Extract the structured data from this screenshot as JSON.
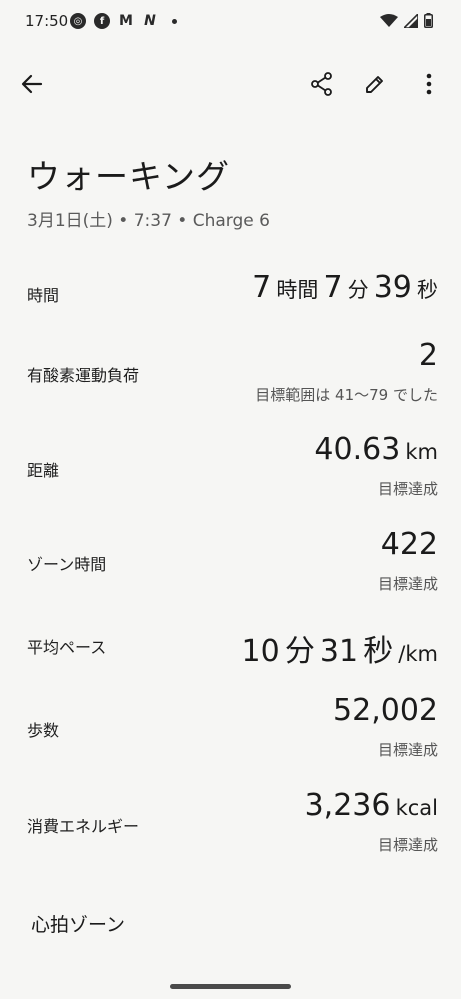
{
  "status_bar": {
    "time": "17:50",
    "left_icons": [
      "activity-icon",
      "facebook-icon",
      "gmail-icon",
      "n-app-icon",
      "notification-dot"
    ],
    "right_icons": [
      "wifi-icon",
      "cell-signal-icon",
      "battery-icon"
    ]
  },
  "app_bar": {
    "back_icon": "arrow-left-icon",
    "actions": [
      "share-icon",
      "edit-icon",
      "more-vert-icon"
    ]
  },
  "header": {
    "title": "ウォーキング",
    "subtitle": "3月1日(土) • 7:37 • Charge 6"
  },
  "stats": {
    "duration": {
      "label": "時間",
      "hours": "7",
      "hours_unit": "時間",
      "minutes": "7",
      "minutes_unit": "分",
      "seconds": "39",
      "seconds_unit": "秒"
    },
    "cardio_load": {
      "label": "有酸素運動負荷",
      "value": "2",
      "note": "目標範囲は 41〜79 でした"
    },
    "distance": {
      "label": "距離",
      "value": "40.63",
      "unit": "km",
      "note": "目標達成"
    },
    "zone_minutes": {
      "label": "ゾーン時間",
      "value": "422",
      "note": "目標達成"
    },
    "avg_pace": {
      "label": "平均ペース",
      "minutes": "10",
      "minutes_unit": "分",
      "seconds": "31",
      "seconds_unit": "秒",
      "per": "/km"
    },
    "steps": {
      "label": "歩数",
      "value": "52,002",
      "note": "目標達成"
    },
    "calories": {
      "label": "消費エネルギー",
      "value": "3,236",
      "unit": "kcal",
      "note": "目標達成"
    }
  },
  "sections": {
    "heart_zones": "心拍ゾーン"
  },
  "colors": {
    "background": "#f6f6f4",
    "text": "#1b1b1b",
    "secondary": "#5a5a5a"
  }
}
